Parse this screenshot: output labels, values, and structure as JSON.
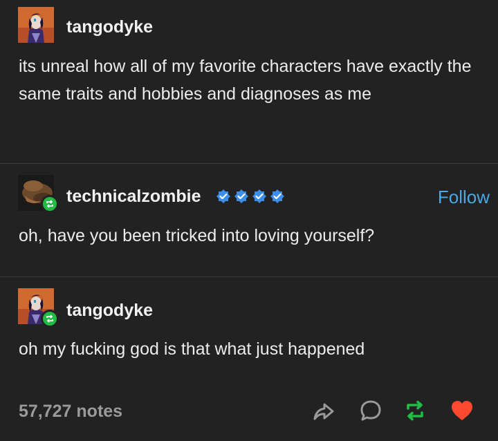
{
  "posts": [
    {
      "username": "tangodyke",
      "text": "its unreal how all of my favorite characters have exactly the same traits and hobbies and diagnoses as me"
    },
    {
      "username": "technicalzombie",
      "follow_label": "Follow",
      "badge_count": 4,
      "text": "oh, have you been tricked into loving yourself?"
    },
    {
      "username": "tangodyke",
      "text": "oh my fucking god is that what just happened"
    }
  ],
  "footer": {
    "notes": "57,727 notes",
    "actions": [
      "share-icon",
      "reply-icon",
      "reblog-icon",
      "like-icon"
    ]
  },
  "colors": {
    "background": "#222222",
    "text": "#ececec",
    "notes": "#9a9a9a",
    "link": "#4aa9e3",
    "reblog": "#22bb44",
    "like": "#ff4930",
    "badge": "#3d8ee8"
  }
}
